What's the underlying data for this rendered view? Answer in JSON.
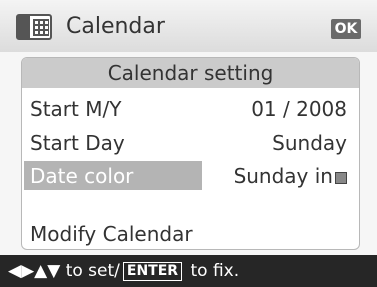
{
  "header": {
    "title": "Calendar",
    "ok_label": "OK",
    "icon": "calendar-icon"
  },
  "panel": {
    "title": "Calendar setting",
    "rows": [
      {
        "label": "Start M/Y",
        "value": "01  /  2008"
      },
      {
        "label": "Start Day",
        "value": "Sunday"
      },
      {
        "label": "Date color",
        "value": "Sunday in",
        "selected": true,
        "value_icon": "color-square-icon"
      },
      {
        "label": "Modify Calendar"
      }
    ]
  },
  "footer": {
    "arrows": "◀▶▲▼",
    "hint_mid": "to set/",
    "enter_key": "ENTER",
    "hint_end": "to fix."
  },
  "colors": {
    "selection": "#b4b4b4",
    "panel_header": "#cbcbcb",
    "footer_bg": "#262626"
  }
}
